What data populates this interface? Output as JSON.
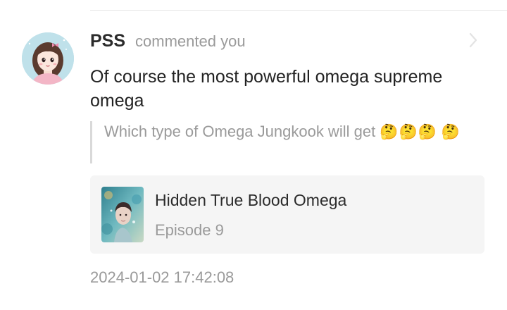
{
  "notification": {
    "username": "PSS",
    "action": "commented you",
    "comment": "Of course the most powerful omega supreme omega",
    "quoted_comment": "Which type of Omega Jungkook will get",
    "quoted_emoji": [
      "🤔",
      "🤔",
      "🤔",
      "🤔"
    ],
    "timestamp": "2024-01-02 17:42:08"
  },
  "episode_card": {
    "series_title": "Hidden True Blood Omega",
    "episode": "Episode 9"
  },
  "icons": {
    "avatar": "user-avatar",
    "chevron": "chevron-right-icon",
    "emoji": "thinking-face-emoji",
    "cover": "series-cover-image"
  },
  "colors": {
    "primary_text": "#222222",
    "secondary_text": "#9a9a9a",
    "card_background": "#f5f5f5",
    "quote_bar": "#d9d9d9"
  }
}
